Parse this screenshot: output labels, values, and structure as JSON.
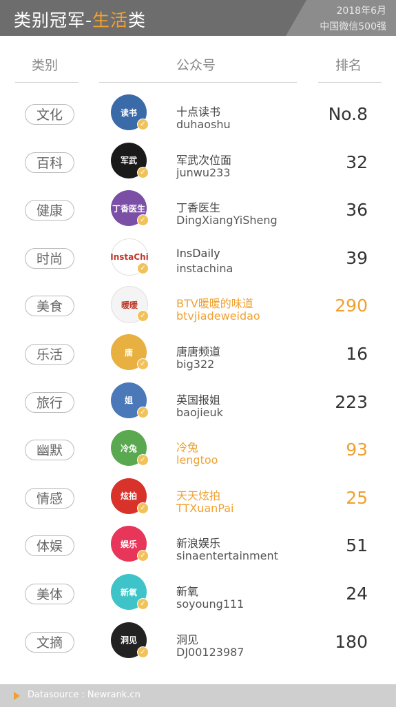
{
  "header": {
    "title_left": "类别冠军-",
    "title_highlight": "生活",
    "title_right": "类",
    "date": "2018年6月",
    "subtitle": "中国微信500强"
  },
  "columns": {
    "category": "类别",
    "account": "公众号",
    "rank": "排名"
  },
  "rows": [
    {
      "category": "文化",
      "name": "十点读书",
      "account": "duhaoshu",
      "rank": "No.8",
      "avatar_text": "读书",
      "avatar_bg": "#3b6aa8",
      "highlight": false
    },
    {
      "category": "百科",
      "name": "军武次位面",
      "account": "junwu233",
      "rank": "32",
      "avatar_text": "军武",
      "avatar_bg": "#1a1a1a",
      "highlight": false
    },
    {
      "category": "健康",
      "name": "丁香医生",
      "account": "DingXiangYiSheng",
      "rank": "36",
      "avatar_text": "丁香医生",
      "avatar_bg": "#7b4fa6",
      "highlight": false
    },
    {
      "category": "时尚",
      "name": "InsDaily",
      "account": "instachina",
      "rank": "39",
      "avatar_text": "InstaChi",
      "avatar_bg": "#ffffff",
      "highlight": false
    },
    {
      "category": "美食",
      "name": "BTV暖暖的味道",
      "account": "btvjiadeweidao",
      "rank": "290",
      "avatar_text": "暖暖",
      "avatar_bg": "#f4f4f4",
      "highlight": true
    },
    {
      "category": "乐活",
      "name": "唐唐频道",
      "account": "big322",
      "rank": "16",
      "avatar_text": "唐",
      "avatar_bg": "#e8b040",
      "highlight": false
    },
    {
      "category": "旅行",
      "name": "英国报姐",
      "account": "baojieuk",
      "rank": "223",
      "avatar_text": "姐",
      "avatar_bg": "#4a78b8",
      "highlight": false
    },
    {
      "category": "幽默",
      "name": "冷兔",
      "account": "lengtoo",
      "rank": "93",
      "avatar_text": "冷兔",
      "avatar_bg": "#5aa850",
      "highlight": true
    },
    {
      "category": "情感",
      "name": "天天炫拍",
      "account": "TTXuanPai",
      "rank": "25",
      "avatar_text": "炫拍",
      "avatar_bg": "#d8322a",
      "highlight": true
    },
    {
      "category": "体娱",
      "name": "新浪娱乐",
      "account": "sinaentertainment",
      "rank": "51",
      "avatar_text": "娱乐",
      "avatar_bg": "#e8355a",
      "highlight": false
    },
    {
      "category": "美体",
      "name": "新氧",
      "account": "soyoung111",
      "rank": "24",
      "avatar_text": "新氧",
      "avatar_bg": "#3ec4c8",
      "highlight": false
    },
    {
      "category": "文摘",
      "name": "洞见",
      "account": "DJ00123987",
      "rank": "180",
      "avatar_text": "洞见",
      "avatar_bg": "#222222",
      "highlight": false
    }
  ],
  "footer": {
    "source": "Datasource : Newrank.cn"
  }
}
